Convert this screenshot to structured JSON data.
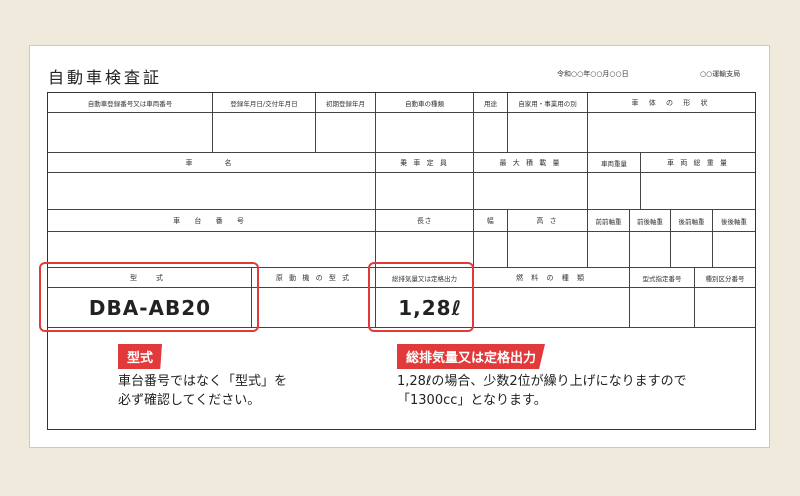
{
  "document": {
    "title": "自動車検査証",
    "issue_date": "令和○○年○○月○○日",
    "issuer": "○○運輸支局"
  },
  "row1_headers": {
    "reg_no": "自動車登録番号又は車両番号",
    "reg_date": "登録年月日/交付年月日",
    "first_reg": "初期登録年月",
    "car_kind": "自動車の種類",
    "usage": "用途",
    "private_business": "自家用・事業用の別",
    "body_shape": "車 体 の 形 状"
  },
  "row2_headers": {
    "car_name": "車　　名",
    "capacity": "乗 車 定 員",
    "max_load": "最 大 積 載 量",
    "vehicle_weight": "車両重量",
    "gross_weight": "車 両 総 重 量"
  },
  "row3_headers": {
    "chassis_no": "車 台 番 号",
    "length": "長さ",
    "width": "幅",
    "height": "高 さ",
    "ff_axle": "前前軸重",
    "fr_axle": "前後軸重",
    "rf_axle": "後前軸重",
    "rr_axle": "後後軸重"
  },
  "row4_headers": {
    "model": "型　式",
    "engine_model": "原 動 機 の 型 式",
    "displacement": "総排気量又は定格出力",
    "fuel": "燃 料 の 種 類",
    "model_designation": "型式指定番号",
    "category_no": "種別区分番号"
  },
  "values": {
    "model": "DBA-AB20",
    "displacement": "1,28ℓ"
  },
  "callouts": {
    "model_tag": "型式",
    "model_note_line1": "車台番号ではなく「型式」を",
    "model_note_line2": "必ず確認してください。",
    "displacement_tag": "総排気量又は定格出力",
    "displacement_note_line1": "1,28ℓの場合、少数2位が繰り上げになりますので",
    "displacement_note_line2": "「1300cc」となります。"
  },
  "colors": {
    "background": "#efeadc",
    "accent_red": "#e23a3a"
  }
}
